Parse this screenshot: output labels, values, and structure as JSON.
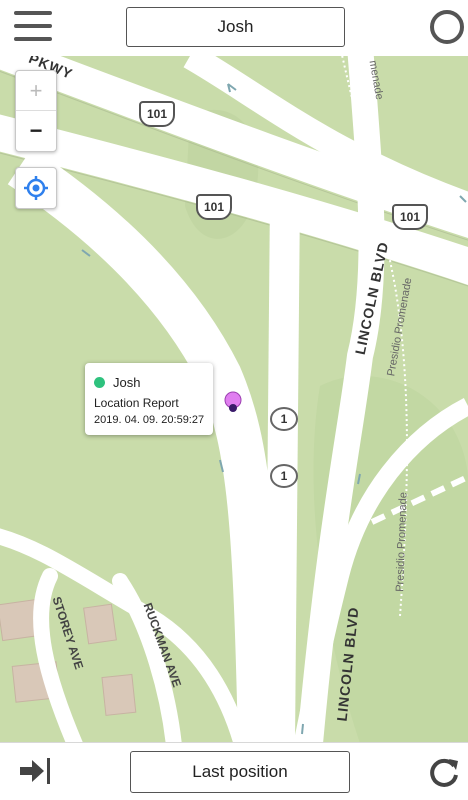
{
  "header": {
    "menu_icon": "hamburger-menu-icon",
    "title": "Josh",
    "status_icon": "circle-outline-icon"
  },
  "map": {
    "zoom_in_label": "+",
    "zoom_out_label": "−",
    "locate_icon": "crosshair-locate-icon",
    "street_labels": {
      "parkway": "PKWY",
      "lincoln_1": "LINCOLN BLVD",
      "lincoln_2": "LINCOLN BLVD",
      "presidio_1": "Presidio Promenade",
      "presidio_2": "Presidio Promenade",
      "presidio_3": "menade",
      "storey": "STOREY AVE",
      "ruckman": "RUCKMAN AVE"
    },
    "route_shields": {
      "us101": "101",
      "state1": "1"
    },
    "colors": {
      "land": "#c9dcaa",
      "road": "#ffffff",
      "building": "#d9c8b8",
      "marker": "#e07ef0"
    }
  },
  "popup": {
    "name": "Josh",
    "report_label": "Location Report",
    "timestamp": "2019. 04. 09. 20:59:27"
  },
  "footer": {
    "exit_icon": "arrow-to-bar-icon",
    "mode_label": "Last position",
    "refresh_icon": "refresh-icon"
  }
}
